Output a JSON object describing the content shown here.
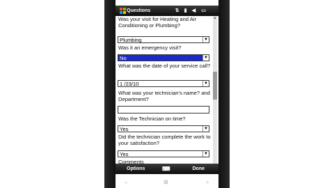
{
  "statusbar": {
    "title": "Questions",
    "icons": [
      "windows-start-icon",
      "network-icon",
      "signal-icon",
      "volume-icon",
      "battery-icon"
    ]
  },
  "form": {
    "q1_text": "Was your visit for Heating and Air Conditioning or Plumbing?",
    "q1_value": "Plumbing",
    "q2_text": "Was it an emergency visit?",
    "q2_value": "No",
    "q3_text": "What was the date of your service call?",
    "q3_value": "1 /23/10",
    "q4_text": "What was your technician's name? and Department?",
    "q4_value": "",
    "q5_text": "Was the Technician on time?",
    "q5_value": "Yes",
    "q6_text": "Did the technician complete the work to your satisfaction?",
    "q6_value": "Yes",
    "q7_text": "Comments"
  },
  "softkeys": {
    "left": "Options",
    "right": "Done"
  },
  "colors": {
    "selection": "#1a2cc8",
    "bar": "#1a1a1a"
  }
}
